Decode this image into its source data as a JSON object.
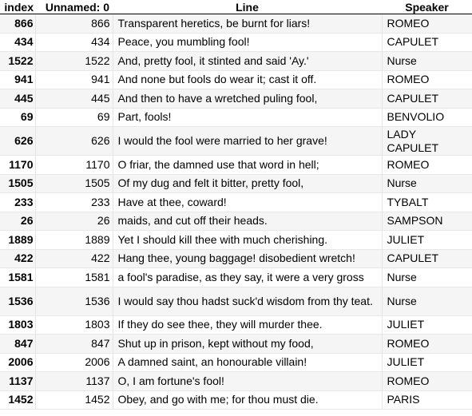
{
  "table": {
    "columns": {
      "index": "index",
      "unnamed": "Unnamed: 0",
      "line": "Line",
      "speaker": "Speaker"
    },
    "rows": [
      {
        "index": "866",
        "unnamed": "866",
        "line": "Transparent heretics, be burnt for liars!",
        "speaker": "ROMEO"
      },
      {
        "index": "434",
        "unnamed": "434",
        "line": "Peace, you mumbling fool!",
        "speaker": "CAPULET"
      },
      {
        "index": "1522",
        "unnamed": "1522",
        "line": "And, pretty fool, it stinted and said 'Ay.'",
        "speaker": "Nurse"
      },
      {
        "index": "941",
        "unnamed": "941",
        "line": "And none but fools do wear it; cast it off.",
        "speaker": "ROMEO"
      },
      {
        "index": "445",
        "unnamed": "445",
        "line": "And then to have a wretched puling fool,",
        "speaker": "CAPULET"
      },
      {
        "index": "69",
        "unnamed": "69",
        "line": "Part, fools!",
        "speaker": "BENVOLIO"
      },
      {
        "index": "626",
        "unnamed": "626",
        "line": "I would the fool were married to her grave!",
        "speaker": "LADY CAPULET"
      },
      {
        "index": "1170",
        "unnamed": "1170",
        "line": "O friar, the damned use that word in hell;",
        "speaker": "ROMEO"
      },
      {
        "index": "1505",
        "unnamed": "1505",
        "line": "Of my dug and felt it bitter, pretty fool,",
        "speaker": "Nurse"
      },
      {
        "index": "233",
        "unnamed": "233",
        "line": "Have at thee, coward!",
        "speaker": "TYBALT"
      },
      {
        "index": "26",
        "unnamed": "26",
        "line": "maids, and cut off their heads.",
        "speaker": "SAMPSON"
      },
      {
        "index": "1889",
        "unnamed": "1889",
        "line": "Yet I should kill thee with much cherishing.",
        "speaker": "JULIET"
      },
      {
        "index": "422",
        "unnamed": "422",
        "line": "Hang thee, young baggage! disobedient wretch!",
        "speaker": "CAPULET"
      },
      {
        "index": "1581",
        "unnamed": "1581",
        "line": "a fool's paradise, as they say, it were a very gross",
        "speaker": "Nurse"
      },
      {
        "index": "1536",
        "unnamed": "1536",
        "line": "I would say thou hadst suck'd wisdom from thy teat.",
        "speaker": "Nurse"
      },
      {
        "index": "1803",
        "unnamed": "1803",
        "line": "If they do see thee, they will murder thee.",
        "speaker": "JULIET"
      },
      {
        "index": "847",
        "unnamed": "847",
        "line": "Shut up in prison, kept without my food,",
        "speaker": "ROMEO"
      },
      {
        "index": "2006",
        "unnamed": "2006",
        "line": "A damned saint, an honourable villain!",
        "speaker": "JULIET"
      },
      {
        "index": "1137",
        "unnamed": "1137",
        "line": "O, I am fortune's fool!",
        "speaker": "ROMEO"
      },
      {
        "index": "1452",
        "unnamed": "1452",
        "line": "Obey, and go with me; for thou must die.",
        "speaker": "PARIS"
      }
    ]
  }
}
